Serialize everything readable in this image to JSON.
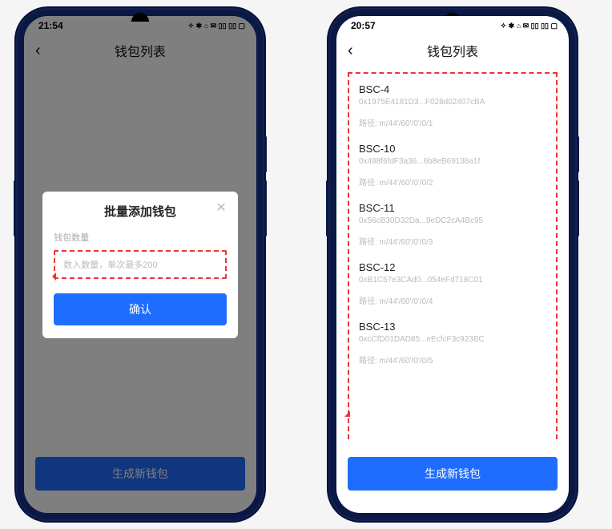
{
  "statusbar_icons": "✧ ✱ ⌂ ✉ ▯▯ ▯▯ ▢",
  "left": {
    "time": "21:54",
    "nav_title": "钱包列表",
    "modal_title": "批量添加钱包",
    "modal_sub": "钱包数量",
    "modal_placeholder": "数入数量，单次最多200",
    "modal_confirm": "确认",
    "bottom_btn": "生成新钱包"
  },
  "right": {
    "time": "20:57",
    "nav_title": "钱包列表",
    "path_label": "路径:",
    "wallets": [
      {
        "name": "BSC-4",
        "addr": "0x1975E4181D3...F028d02407cBA",
        "path": "m/44'/60'/0'/0/1"
      },
      {
        "name": "BSC-10",
        "addr": "0x498f6fdF3a36...6b8eB69136a1f",
        "path": "m/44'/60'/0'/0/2"
      },
      {
        "name": "BSC-11",
        "addr": "0x56cB30D32Da...9eDC2cA4Bc95",
        "path": "m/44'/60'/0'/0/3"
      },
      {
        "name": "BSC-12",
        "addr": "0xB1C57e3CAd0...054eFd718C01",
        "path": "m/44'/60'/0'/0/4"
      },
      {
        "name": "BSC-13",
        "addr": "0xcCfD01DAD85...eEcfcF3c923BC",
        "path": "m/44'/60'/0'/0/5"
      }
    ],
    "bottom_btn": "生成新钱包"
  }
}
